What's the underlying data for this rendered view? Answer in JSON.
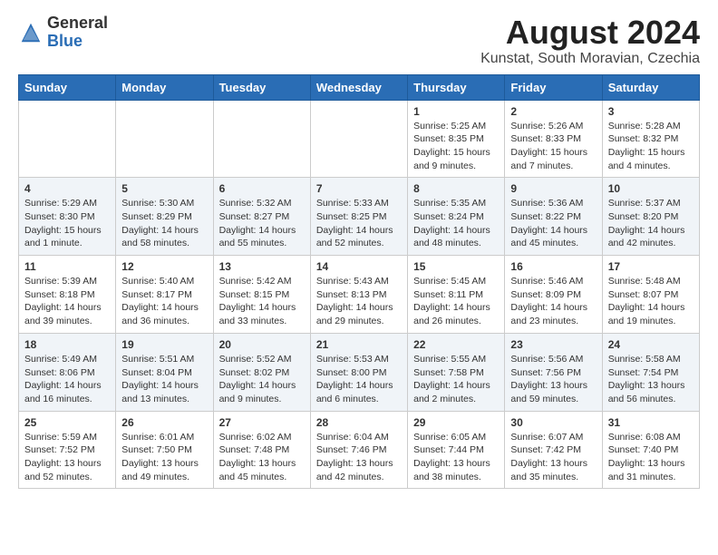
{
  "header": {
    "logo": {
      "general": "General",
      "blue": "Blue"
    },
    "title": "August 2024",
    "subtitle": "Kunstat, South Moravian, Czechia"
  },
  "weekdays": [
    "Sunday",
    "Monday",
    "Tuesday",
    "Wednesday",
    "Thursday",
    "Friday",
    "Saturday"
  ],
  "weeks": [
    [
      {
        "day": "",
        "info": ""
      },
      {
        "day": "",
        "info": ""
      },
      {
        "day": "",
        "info": ""
      },
      {
        "day": "",
        "info": ""
      },
      {
        "day": "1",
        "info": "Sunrise: 5:25 AM\nSunset: 8:35 PM\nDaylight: 15 hours and 9 minutes."
      },
      {
        "day": "2",
        "info": "Sunrise: 5:26 AM\nSunset: 8:33 PM\nDaylight: 15 hours and 7 minutes."
      },
      {
        "day": "3",
        "info": "Sunrise: 5:28 AM\nSunset: 8:32 PM\nDaylight: 15 hours and 4 minutes."
      }
    ],
    [
      {
        "day": "4",
        "info": "Sunrise: 5:29 AM\nSunset: 8:30 PM\nDaylight: 15 hours and 1 minute."
      },
      {
        "day": "5",
        "info": "Sunrise: 5:30 AM\nSunset: 8:29 PM\nDaylight: 14 hours and 58 minutes."
      },
      {
        "day": "6",
        "info": "Sunrise: 5:32 AM\nSunset: 8:27 PM\nDaylight: 14 hours and 55 minutes."
      },
      {
        "day": "7",
        "info": "Sunrise: 5:33 AM\nSunset: 8:25 PM\nDaylight: 14 hours and 52 minutes."
      },
      {
        "day": "8",
        "info": "Sunrise: 5:35 AM\nSunset: 8:24 PM\nDaylight: 14 hours and 48 minutes."
      },
      {
        "day": "9",
        "info": "Sunrise: 5:36 AM\nSunset: 8:22 PM\nDaylight: 14 hours and 45 minutes."
      },
      {
        "day": "10",
        "info": "Sunrise: 5:37 AM\nSunset: 8:20 PM\nDaylight: 14 hours and 42 minutes."
      }
    ],
    [
      {
        "day": "11",
        "info": "Sunrise: 5:39 AM\nSunset: 8:18 PM\nDaylight: 14 hours and 39 minutes."
      },
      {
        "day": "12",
        "info": "Sunrise: 5:40 AM\nSunset: 8:17 PM\nDaylight: 14 hours and 36 minutes."
      },
      {
        "day": "13",
        "info": "Sunrise: 5:42 AM\nSunset: 8:15 PM\nDaylight: 14 hours and 33 minutes."
      },
      {
        "day": "14",
        "info": "Sunrise: 5:43 AM\nSunset: 8:13 PM\nDaylight: 14 hours and 29 minutes."
      },
      {
        "day": "15",
        "info": "Sunrise: 5:45 AM\nSunset: 8:11 PM\nDaylight: 14 hours and 26 minutes."
      },
      {
        "day": "16",
        "info": "Sunrise: 5:46 AM\nSunset: 8:09 PM\nDaylight: 14 hours and 23 minutes."
      },
      {
        "day": "17",
        "info": "Sunrise: 5:48 AM\nSunset: 8:07 PM\nDaylight: 14 hours and 19 minutes."
      }
    ],
    [
      {
        "day": "18",
        "info": "Sunrise: 5:49 AM\nSunset: 8:06 PM\nDaylight: 14 hours and 16 minutes."
      },
      {
        "day": "19",
        "info": "Sunrise: 5:51 AM\nSunset: 8:04 PM\nDaylight: 14 hours and 13 minutes."
      },
      {
        "day": "20",
        "info": "Sunrise: 5:52 AM\nSunset: 8:02 PM\nDaylight: 14 hours and 9 minutes."
      },
      {
        "day": "21",
        "info": "Sunrise: 5:53 AM\nSunset: 8:00 PM\nDaylight: 14 hours and 6 minutes."
      },
      {
        "day": "22",
        "info": "Sunrise: 5:55 AM\nSunset: 7:58 PM\nDaylight: 14 hours and 2 minutes."
      },
      {
        "day": "23",
        "info": "Sunrise: 5:56 AM\nSunset: 7:56 PM\nDaylight: 13 hours and 59 minutes."
      },
      {
        "day": "24",
        "info": "Sunrise: 5:58 AM\nSunset: 7:54 PM\nDaylight: 13 hours and 56 minutes."
      }
    ],
    [
      {
        "day": "25",
        "info": "Sunrise: 5:59 AM\nSunset: 7:52 PM\nDaylight: 13 hours and 52 minutes."
      },
      {
        "day": "26",
        "info": "Sunrise: 6:01 AM\nSunset: 7:50 PM\nDaylight: 13 hours and 49 minutes."
      },
      {
        "day": "27",
        "info": "Sunrise: 6:02 AM\nSunset: 7:48 PM\nDaylight: 13 hours and 45 minutes."
      },
      {
        "day": "28",
        "info": "Sunrise: 6:04 AM\nSunset: 7:46 PM\nDaylight: 13 hours and 42 minutes."
      },
      {
        "day": "29",
        "info": "Sunrise: 6:05 AM\nSunset: 7:44 PM\nDaylight: 13 hours and 38 minutes."
      },
      {
        "day": "30",
        "info": "Sunrise: 6:07 AM\nSunset: 7:42 PM\nDaylight: 13 hours and 35 minutes."
      },
      {
        "day": "31",
        "info": "Sunrise: 6:08 AM\nSunset: 7:40 PM\nDaylight: 13 hours and 31 minutes."
      }
    ]
  ]
}
